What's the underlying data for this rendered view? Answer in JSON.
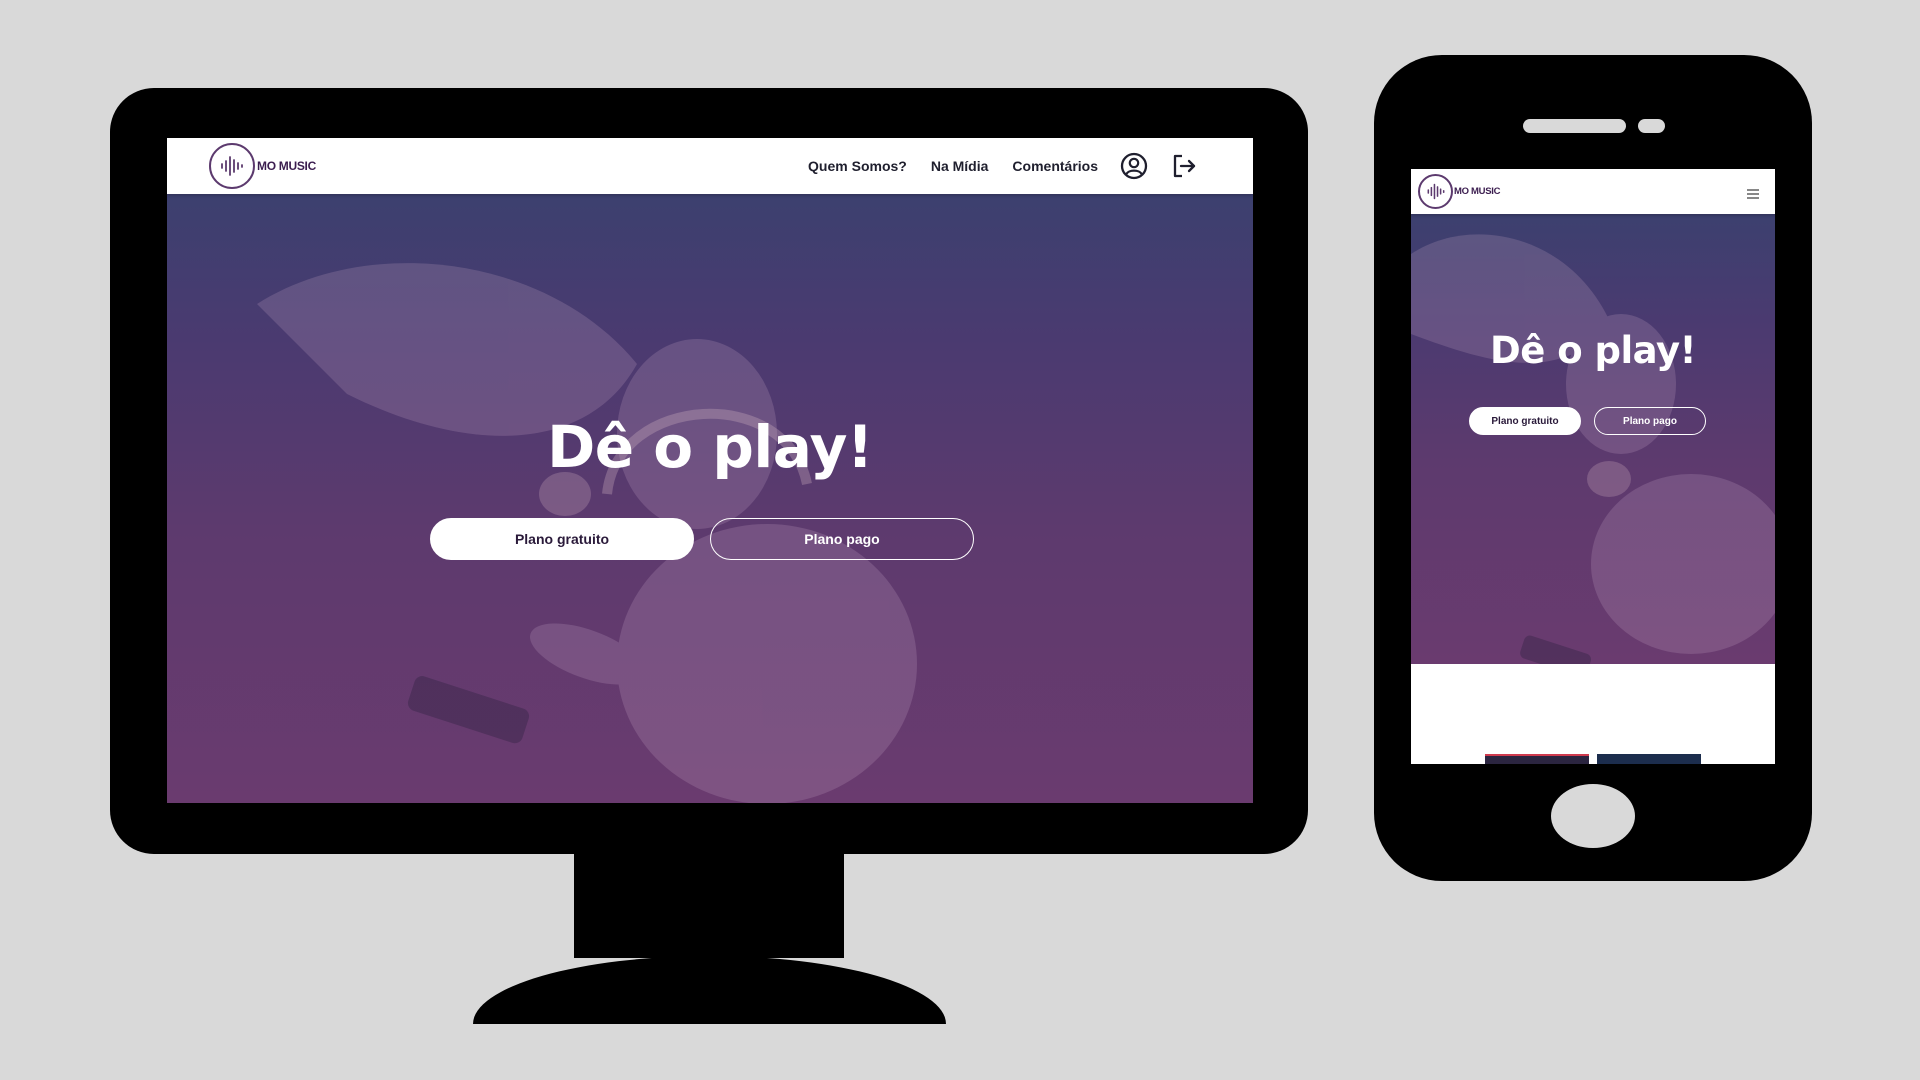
{
  "desktop": {
    "brand": {
      "name": "MO MUSIC"
    },
    "nav": {
      "links": [
        "Quem Somos?",
        "Na Mídia",
        "Comentários"
      ],
      "icons": [
        "user-circle-icon",
        "logout-icon"
      ]
    },
    "hero": {
      "title": "Dê o play!",
      "primary_button": "Plano gratuito",
      "secondary_button": "Plano pago"
    }
  },
  "mobile": {
    "brand": {
      "name": "MO MUSIC"
    },
    "nav": {
      "icons": [
        "hamburger-menu-icon"
      ]
    },
    "hero": {
      "title": "Dê o play!",
      "primary_button": "Plano gratuito",
      "secondary_button": "Plano pago"
    }
  },
  "colors": {
    "background": "#d9d9d9",
    "device": "#000000",
    "brand_purple": "#5c3a6e",
    "hero_top": "#3c406f",
    "hero_bottom": "#6a3b6f"
  }
}
